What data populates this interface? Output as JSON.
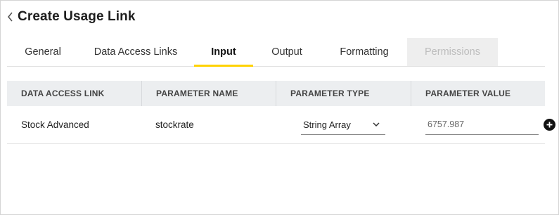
{
  "header": {
    "title": "Create Usage Link",
    "back_icon": "chevron-left-icon"
  },
  "tabs": [
    {
      "label": "General",
      "state": "normal"
    },
    {
      "label": "Data Access Links",
      "state": "normal"
    },
    {
      "label": "Input",
      "state": "active"
    },
    {
      "label": "Output",
      "state": "normal"
    },
    {
      "label": "Formatting",
      "state": "normal"
    },
    {
      "label": "Permissions",
      "state": "disabled"
    }
  ],
  "table": {
    "columns": [
      "DATA ACCESS LINK",
      "PARAMETER NAME",
      "PARAMETER TYPE",
      "PARAMETER VALUE"
    ],
    "rows": [
      {
        "data_access_link": "Stock Advanced",
        "parameter_name": "stockrate",
        "parameter_type": "String Array",
        "parameter_value": "6757.987"
      }
    ]
  },
  "colors": {
    "accent": "#ffd200",
    "header_bg": "#eceef0",
    "disabled_tab_bg": "#eeeeee"
  }
}
